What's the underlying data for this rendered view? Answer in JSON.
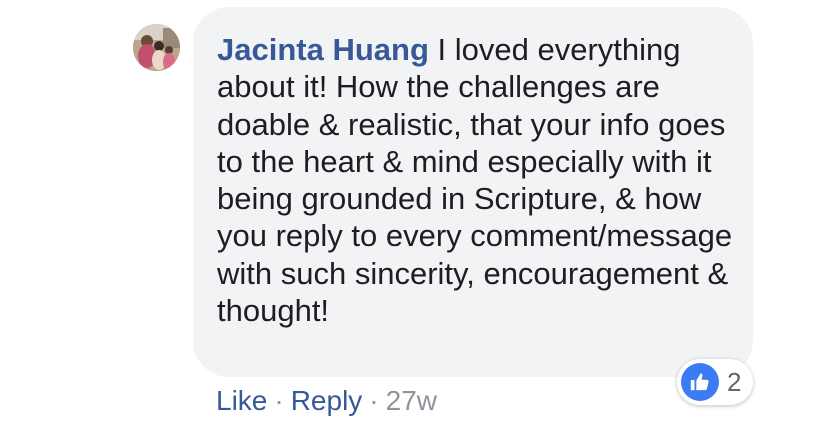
{
  "comment": {
    "author": "Jacinta Huang",
    "text": "I loved everything about it! How the challenges are doable & realistic, that your info goes to the heart & mind especially with it being grounded in Scripture, & how you reply to every comment/message with such sincerity, encouragement & thought!",
    "reactions": {
      "icon": "like-icon",
      "count": "2",
      "color": "#3b7cf4"
    }
  },
  "actions": {
    "like_label": "Like",
    "separator": "·",
    "reply_label": "Reply",
    "timestamp": "27w"
  },
  "colors": {
    "author": "#385898",
    "bubble_bg": "#f2f3f5",
    "text": "#1c1e21",
    "meta": "#90949c"
  }
}
